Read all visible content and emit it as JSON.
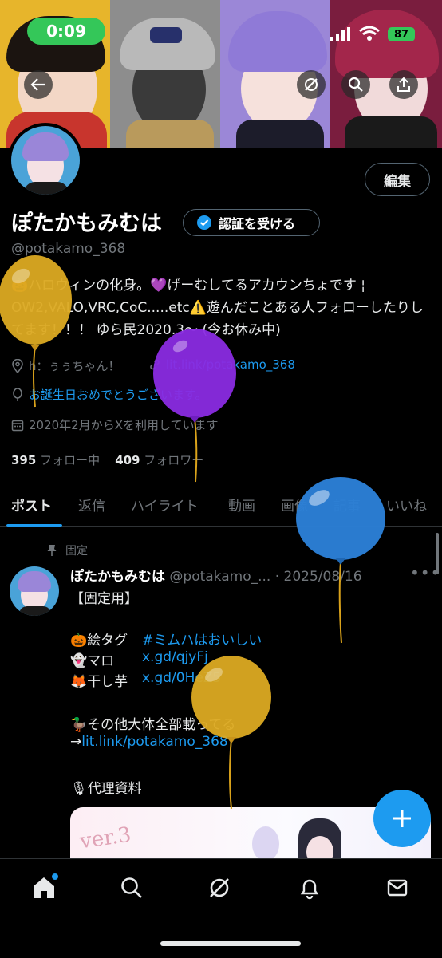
{
  "status_bar": {
    "time": "0:09",
    "battery": "87"
  },
  "profile": {
    "display_name": "ぽたかもみむは",
    "verify_label": "認証を受ける",
    "handle": "@potakamo_368",
    "edit_label": "編集",
    "bio": "🎃ハロウィンの化身。💜げーむしてるアカウンちょです ¦ OW2,VALO,VRC,CoC.....etc⚠️遊んだことある人フォローしたりしてます！！！ ゆら民2020.3〜 (今お休み中)",
    "location": "h：ぅぅちゃん！",
    "website": "lit.link/potakamo_368",
    "birthday_text": "お誕生日おめでとうございます。",
    "joined": "2020年2月からXを利用しています",
    "following_count": "395",
    "following_label": "フォロー中",
    "followers_count": "409",
    "followers_label": "フォロワー"
  },
  "tabs": [
    "ポスト",
    "返信",
    "ハイライト",
    "動画",
    "画像",
    "記事",
    "いいね"
  ],
  "post": {
    "pinned_label": "固定",
    "author_name": "ぽたかもみむは",
    "author_handle": "@potakamo_...",
    "date": "· 2025/08/16",
    "lines": {
      "l1": "【固定用】",
      "l2_prefix": "🎃絵タグ",
      "l2_value": "#ミムハはおいしい",
      "l3_prefix": "👻マロ",
      "l3_value": "x.gd/qjyFj",
      "l4_prefix": "🦊干し芋",
      "l4_value": "x.gd/0HeZ5",
      "l5": "🦆その他大体全部載ってる",
      "l6_prefix": "→",
      "l6_value": "lit.link/potakamo_368",
      "l7": "🎙代理資料"
    },
    "media_text": "ver.3"
  },
  "icons": {
    "back": "back-arrow-icon",
    "grok": "grok-icon",
    "search": "search-icon",
    "share": "share-icon",
    "verified": "verified-badge-icon",
    "location": "location-pin-icon",
    "link": "link-icon",
    "balloon": "balloon-icon",
    "calendar": "calendar-icon",
    "pin": "pin-icon",
    "home": "home-icon",
    "notifications": "bell-icon",
    "messages": "mail-icon",
    "compose": "plus-icon"
  },
  "colors": {
    "accent": "#1d9bf0",
    "status_green": "#34c759",
    "background": "#000000"
  }
}
